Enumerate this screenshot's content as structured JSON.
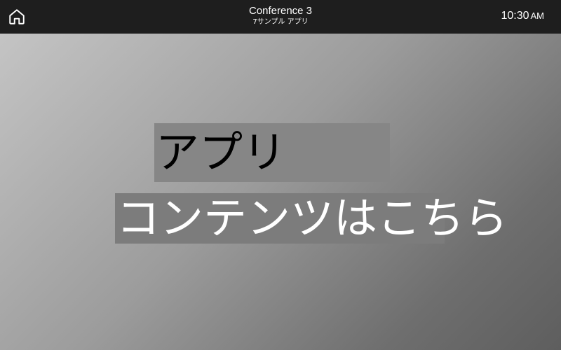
{
  "header": {
    "home_icon": "home-icon",
    "room_name": "Conference 3",
    "app_name": "7サンプル アプリ",
    "clock": {
      "time": "10:30",
      "ampm": "AM"
    }
  },
  "content": {
    "line1": "アプリ",
    "line2": "コンテンツはこちら"
  },
  "colors": {
    "header_bg": "#1e1e1e",
    "header_text": "#ffffff",
    "line1_text": "#000000",
    "line2_text": "#ffffff",
    "gradient_start": "#c4c4c4",
    "gradient_end": "#5e5e5e"
  }
}
